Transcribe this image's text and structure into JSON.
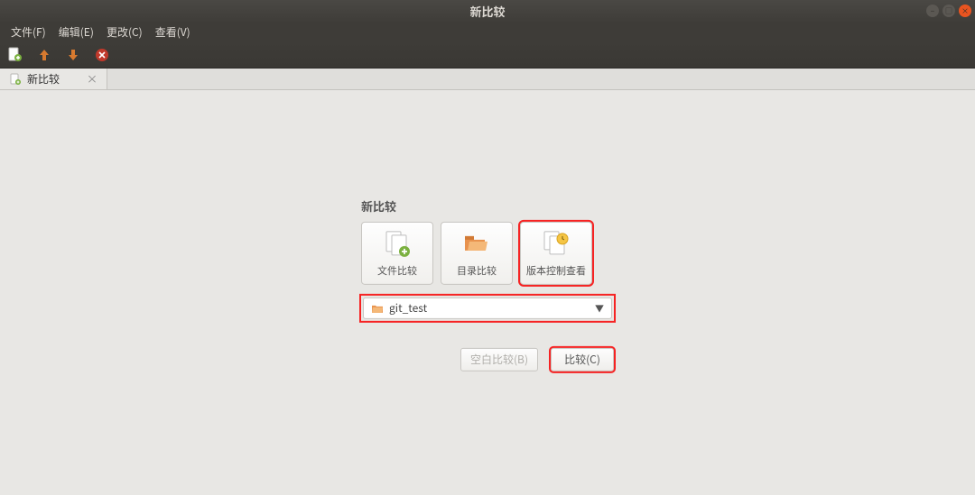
{
  "window": {
    "title": "新比较"
  },
  "menu": {
    "file": "文件(F)",
    "edit": "编辑(E)",
    "change": "更改(C)",
    "view": "查看(V)"
  },
  "tab": {
    "label": "新比较"
  },
  "panel": {
    "heading": "新比较",
    "choices": {
      "file": "文件比较",
      "dir": "目录比较",
      "vcs": "版本控制查看"
    },
    "folder": "git_test",
    "actions": {
      "blank": "空白比较(B)",
      "compare": "比较(C)"
    }
  },
  "colors": {
    "accent": "#e95420",
    "highlight": "#f62323"
  }
}
